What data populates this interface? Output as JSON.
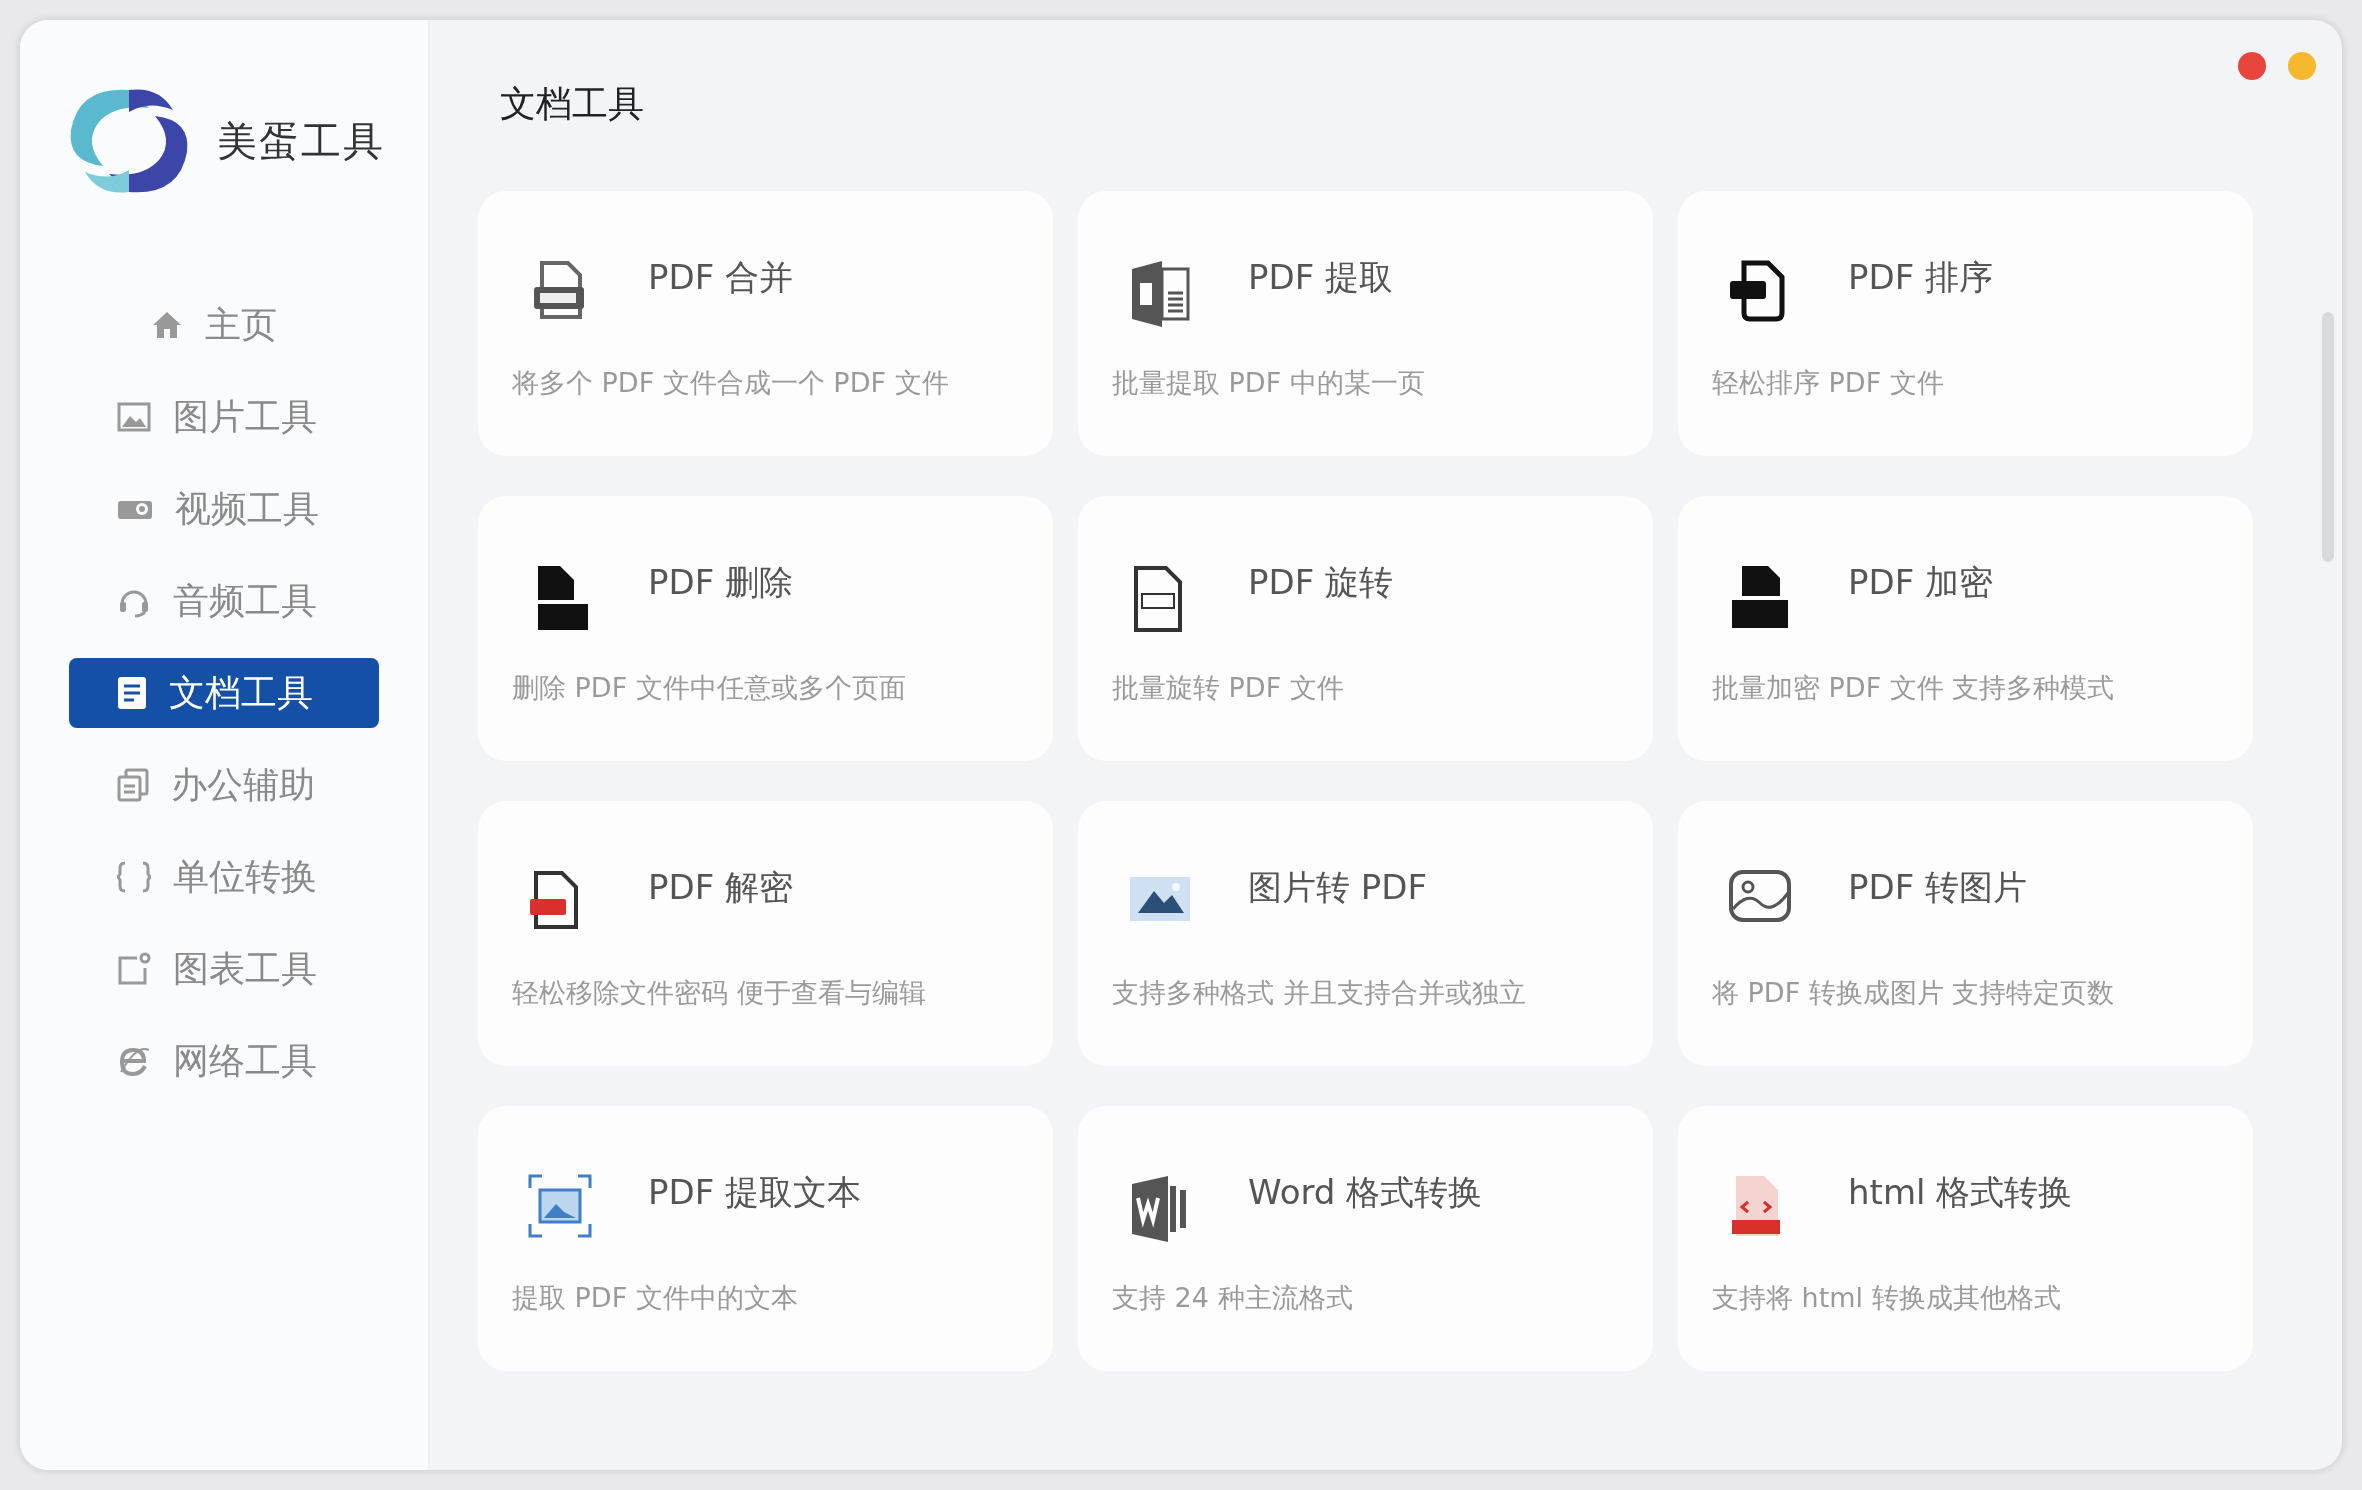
{
  "sidebar": {
    "brand": "美蛋工具",
    "items": [
      {
        "label": "主页",
        "selected": false
      },
      {
        "label": "图片工具",
        "selected": false
      },
      {
        "label": "视频工具",
        "selected": false
      },
      {
        "label": "音频工具",
        "selected": false
      },
      {
        "label": "文档工具",
        "selected": true
      },
      {
        "label": "办公辅助",
        "selected": false
      },
      {
        "label": "单位转换",
        "selected": false
      },
      {
        "label": "图表工具",
        "selected": false
      },
      {
        "label": "网络工具",
        "selected": false
      }
    ]
  },
  "main": {
    "title": "文档工具",
    "tools": [
      {
        "title": "PDF 合并",
        "description": "将多个 PDF 文件合成一个 PDF 文件"
      },
      {
        "title": "PDF 提取",
        "description": "批量提取 PDF 中的某一页"
      },
      {
        "title": "PDF 排序",
        "description": "轻松排序 PDF 文件"
      },
      {
        "title": "PDF 删除",
        "description": "删除 PDF 文件中任意或多个页面"
      },
      {
        "title": "PDF 旋转",
        "description": "批量旋转 PDF 文件"
      },
      {
        "title": "PDF 加密",
        "description": "批量加密 PDF 文件 支持多种模式"
      },
      {
        "title": "PDF 解密",
        "description": "轻松移除文件密码 便于查看与编辑"
      },
      {
        "title": "图片转 PDF",
        "description": "支持多种格式 并且支持合并或独立"
      },
      {
        "title": "PDF 转图片",
        "description": "将 PDF 转换成图片 支持特定页数"
      },
      {
        "title": "PDF 提取文本",
        "description": "提取 PDF 文件中的文本"
      },
      {
        "title": "Word 格式转换",
        "description": "支持 24 种主流格式"
      },
      {
        "title": "html 格式转换",
        "description": "支持将 html 转换成其他格式"
      }
    ]
  }
}
